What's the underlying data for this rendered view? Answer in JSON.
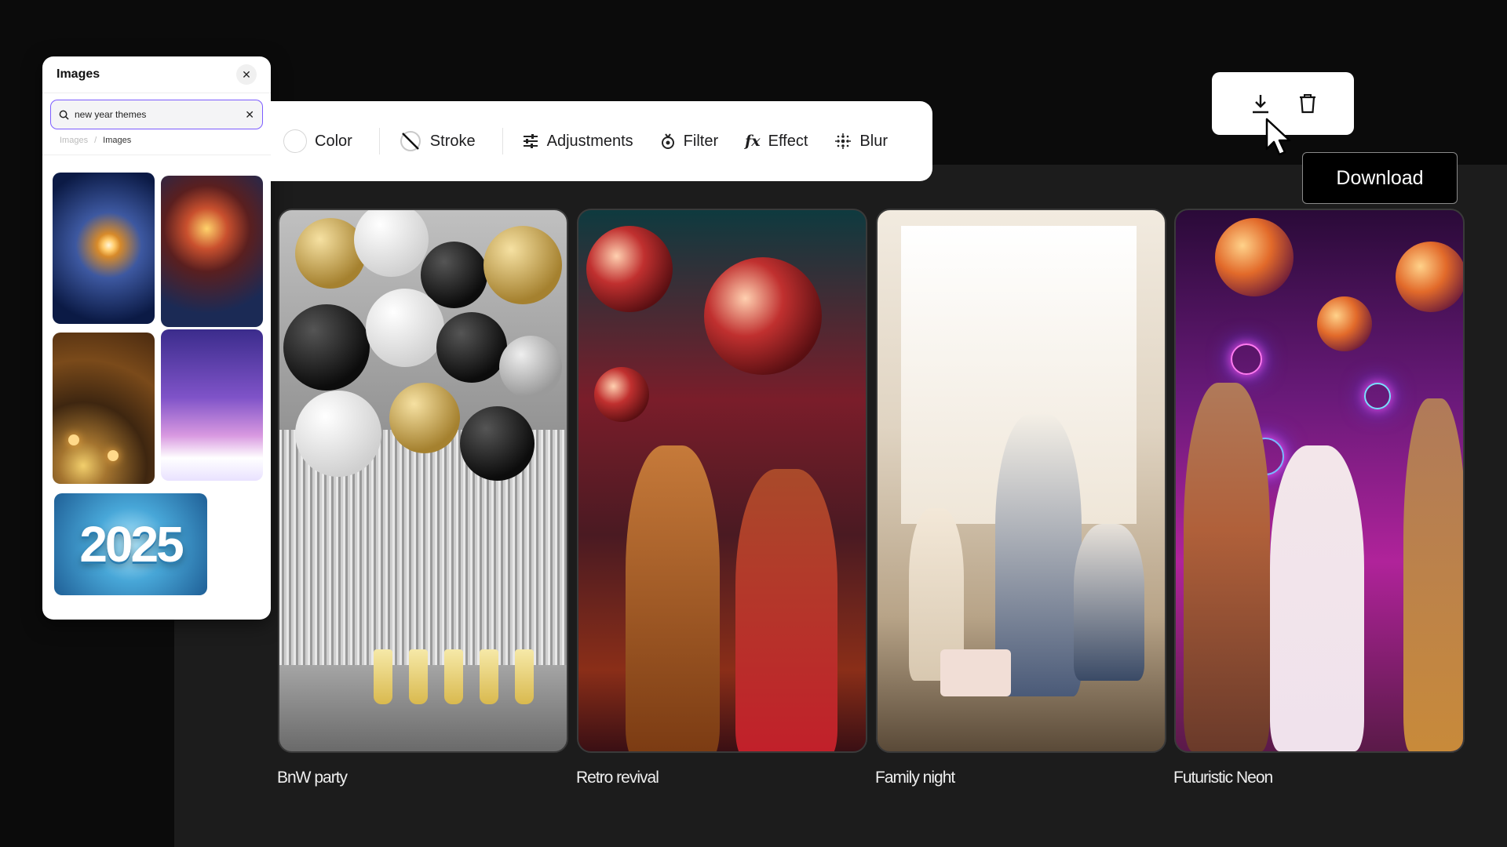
{
  "images_panel": {
    "title": "Images",
    "search": {
      "value": "new year themes"
    },
    "breadcrumb": [
      "Images",
      "Images"
    ],
    "thumbnail_text": "2025"
  },
  "toolbar": {
    "color_label": "Color",
    "stroke_label": "Stroke",
    "adjustments_label": "Adjustments",
    "filter_label": "Filter",
    "effect_label": "Effect",
    "blur_label": "Blur"
  },
  "actions": {
    "download_icon": "download-icon",
    "delete_icon": "trash-icon",
    "tooltip": "Download"
  },
  "gallery": [
    {
      "label": "BnW party"
    },
    {
      "label": "Retro revival"
    },
    {
      "label": "Family night"
    },
    {
      "label": "Futuristic Neon"
    }
  ],
  "colors": {
    "accent": "#7c5cff",
    "background": "#0b0b0b",
    "panel": "#ffffff"
  }
}
